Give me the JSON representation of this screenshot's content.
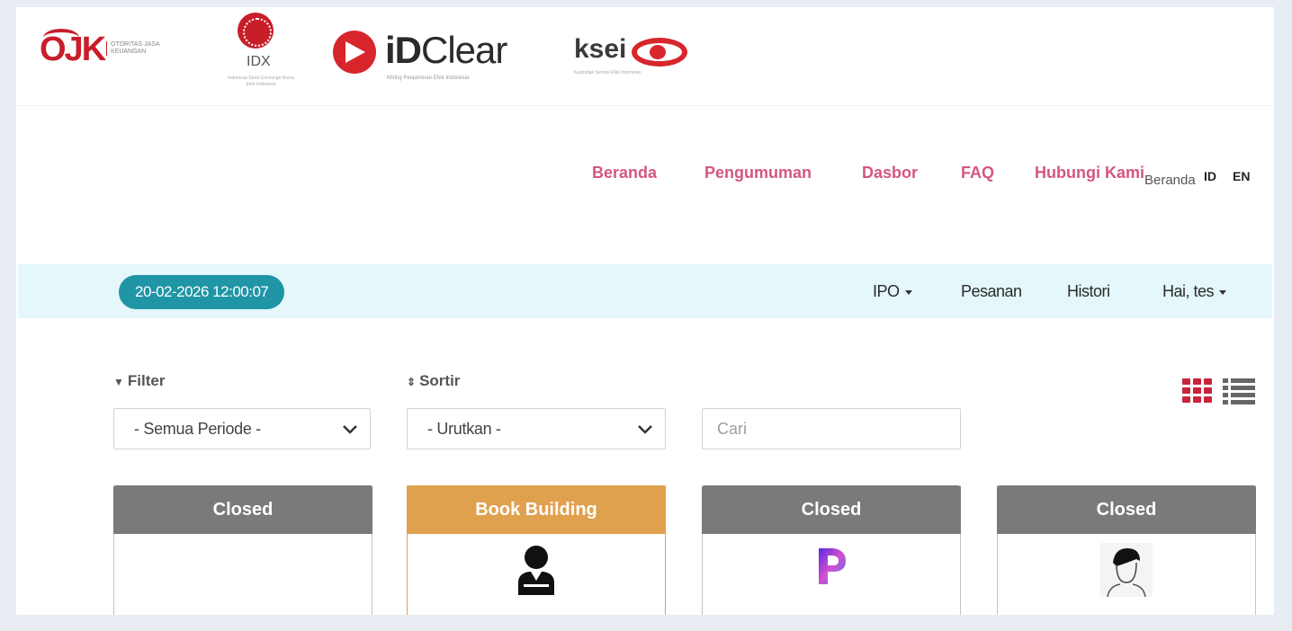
{
  "logos": {
    "ojk": {
      "mark": "OJK",
      "text": "OTORITAS JASA KEUANGAN"
    },
    "idx": {
      "text": "IDX",
      "sub": "Indonesia Stock Exchange Bursa Efek Indonesia"
    },
    "idclear": {
      "prefix": "iD",
      "suffix": "Clear",
      "tag": "Kliring Penjaminan Efek Indonesia"
    },
    "ksei": {
      "word": "ksei",
      "tag": "Kustodian Sentral Efek Indonesia"
    }
  },
  "main_nav": {
    "items": [
      {
        "label": "Beranda"
      },
      {
        "label": "Pengumuman"
      },
      {
        "label": "Dasbor"
      },
      {
        "label": "FAQ"
      },
      {
        "label": "Hubungi Kami"
      }
    ],
    "breadcrumb": "Beranda",
    "lang_id": "ID",
    "lang_en": "EN",
    "link_color": "#d3577f"
  },
  "sub_bar": {
    "datetime": "20-02-2026 12:00:07",
    "menu": [
      {
        "label": "IPO",
        "dropdown": true
      },
      {
        "label": "Pesanan",
        "dropdown": false
      },
      {
        "label": "Histori",
        "dropdown": false
      },
      {
        "label": "Hai, tes",
        "dropdown": true
      }
    ],
    "accent": "#1f95a6"
  },
  "filters": {
    "filter_label": "Filter",
    "filter_icon": "funnel-icon",
    "filter_value": "- Semua Periode -",
    "sort_label": "Sortir",
    "sort_icon": "sort-icon",
    "sort_value": "- Urutkan -",
    "search_placeholder": "Cari"
  },
  "view_toggle": {
    "grid_icon": "grid-icon",
    "list_icon": "list-icon",
    "active": "grid",
    "active_color": "#c8243c"
  },
  "cards": [
    {
      "status": "Closed",
      "type": "closed",
      "logo": "none"
    },
    {
      "status": "Book Building",
      "type": "book",
      "logo": "person-silhouette-icon"
    },
    {
      "status": "Closed",
      "type": "closed",
      "logo": "p-logo-icon"
    },
    {
      "status": "Closed",
      "type": "closed",
      "logo": "face-sketch-icon"
    }
  ]
}
